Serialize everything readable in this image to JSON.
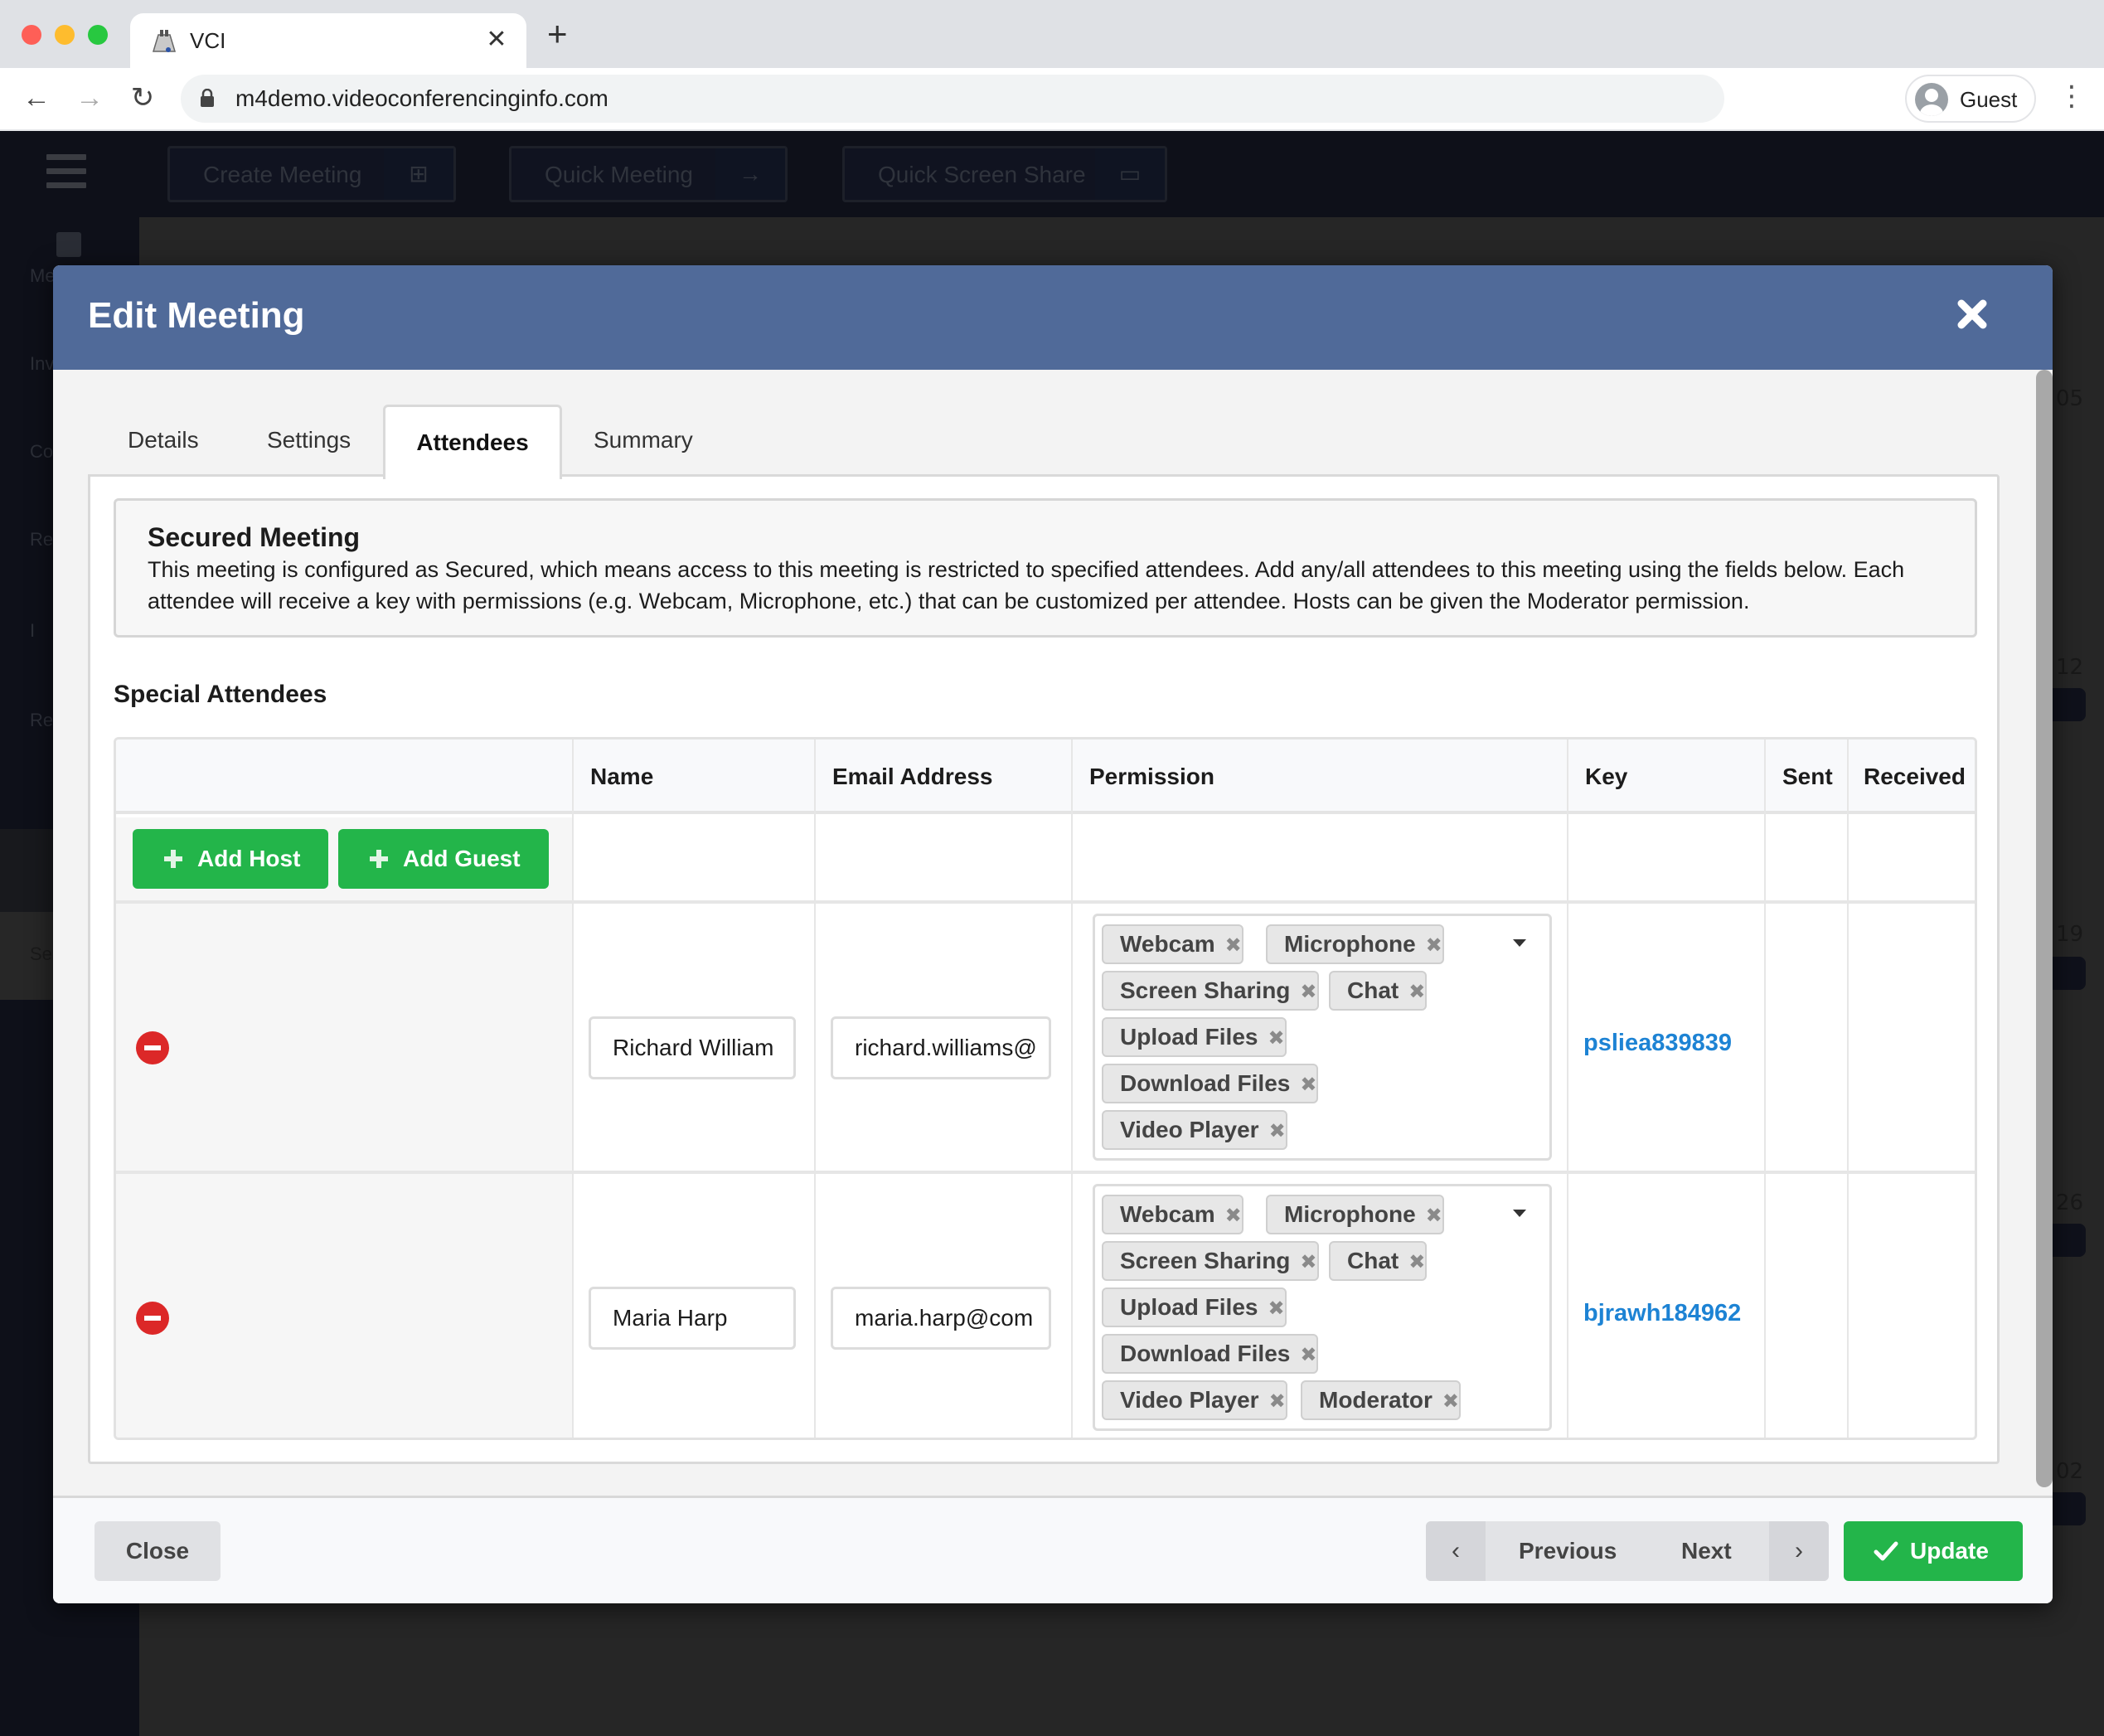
{
  "browser": {
    "tab_title": "VCI",
    "tab_close_glyph": "✕",
    "new_tab_glyph": "+",
    "url": "m4demo.videoconferencinginfo.com",
    "profile_name": "Guest",
    "nav": {
      "back": "←",
      "forward": "→",
      "reload": "↻",
      "menu": "⋮"
    }
  },
  "app": {
    "actions": [
      {
        "label": "Create Meeting",
        "icon": "calendar-plus-icon",
        "glyph": "⊞"
      },
      {
        "label": "Quick Meeting",
        "icon": "arrow-right-icon",
        "glyph": "→"
      },
      {
        "label": "Quick Screen Share",
        "icon": "monitor-icon",
        "glyph": "▭"
      }
    ],
    "sidebar": [
      {
        "label": "Me"
      },
      {
        "label": "Inv"
      },
      {
        "label": "Co"
      },
      {
        "label": "Rec"
      },
      {
        "label": "I"
      },
      {
        "label": "Re"
      },
      {
        "label": "Se"
      }
    ],
    "calendar_dates": [
      "05",
      "12",
      "19",
      "26",
      "02"
    ]
  },
  "modal": {
    "title": "Edit Meeting",
    "tabs": [
      {
        "label": "Details",
        "active": false
      },
      {
        "label": "Settings",
        "active": false
      },
      {
        "label": "Attendees",
        "active": true
      },
      {
        "label": "Summary",
        "active": false
      }
    ],
    "notice": {
      "title": "Secured Meeting",
      "text": "This meeting is configured as Secured, which means access to this meeting is restricted to specified attendees. Add any/all attendees to this meeting using the fields below. Each attendee will receive a key with permissions (e.g. Webcam, Microphone, etc.) that can be customized per attendee. Hosts can be given the Moderator permission."
    },
    "section_title": "Special Attendees",
    "table": {
      "columns": [
        "",
        "Name",
        "Email Address",
        "Permission",
        "Key",
        "Sent",
        "Received"
      ],
      "add_host_label": "Add Host",
      "add_guest_label": "Add Guest",
      "rows": [
        {
          "name": "Richard Williams",
          "name_visible": "Richard William",
          "email_visible": "richard.williams@",
          "permissions": [
            "Webcam",
            "Microphone",
            "Screen Sharing",
            "Chat",
            "Upload Files",
            "Download Files",
            "Video Player"
          ],
          "key": "psliea839839",
          "sent": "",
          "received": ""
        },
        {
          "name": "Maria Harp",
          "name_visible": "Maria Harp",
          "email_visible": "maria.harp@com",
          "permissions": [
            "Webcam",
            "Microphone",
            "Screen Sharing",
            "Chat",
            "Upload Files",
            "Download Files",
            "Video Player",
            "Moderator"
          ],
          "key": "bjrawh184962",
          "sent": "",
          "received": ""
        }
      ],
      "chip_remove_glyph": "✖"
    },
    "footer": {
      "close_label": "Close",
      "previous_label": "Previous",
      "next_label": "Next",
      "prev_arrow": "‹",
      "next_arrow": "›",
      "update_label": "Update"
    }
  },
  "colors": {
    "modal_header": "#506a99",
    "primary_green": "#23b54a",
    "remove_red": "#dc2828",
    "key_link": "#1d83d4"
  }
}
